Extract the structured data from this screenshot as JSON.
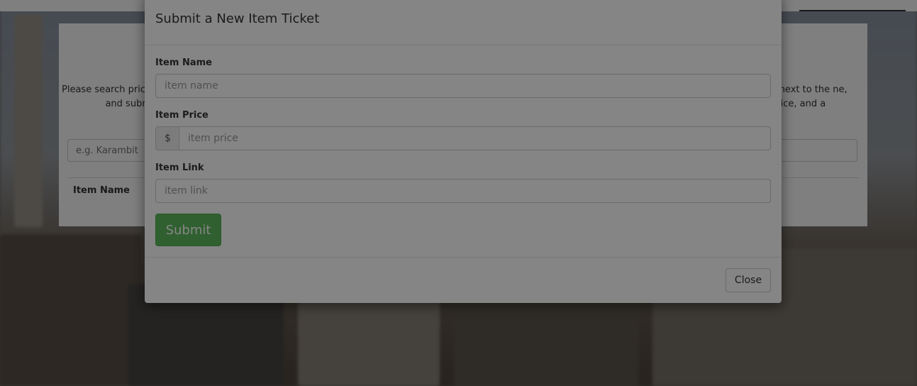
{
  "page": {
    "intro_left": "Please search price and subm",
    "intro_right": "next to the ne, price, and a",
    "question_icon": "?",
    "search_placeholder": "e.g. Karambit",
    "column_header": "Item Name"
  },
  "modal": {
    "title": "Submit a New Item Ticket",
    "fields": {
      "name_label": "Item Name",
      "name_placeholder": "item name",
      "price_label": "Item Price",
      "price_addon": "$",
      "price_placeholder": "item price",
      "link_label": "Item Link",
      "link_placeholder": "item link"
    },
    "submit_label": "Submit",
    "close_label": "Close"
  },
  "colors": {
    "submit_green": "#5cb85c",
    "accent_red": "#d9534f"
  }
}
